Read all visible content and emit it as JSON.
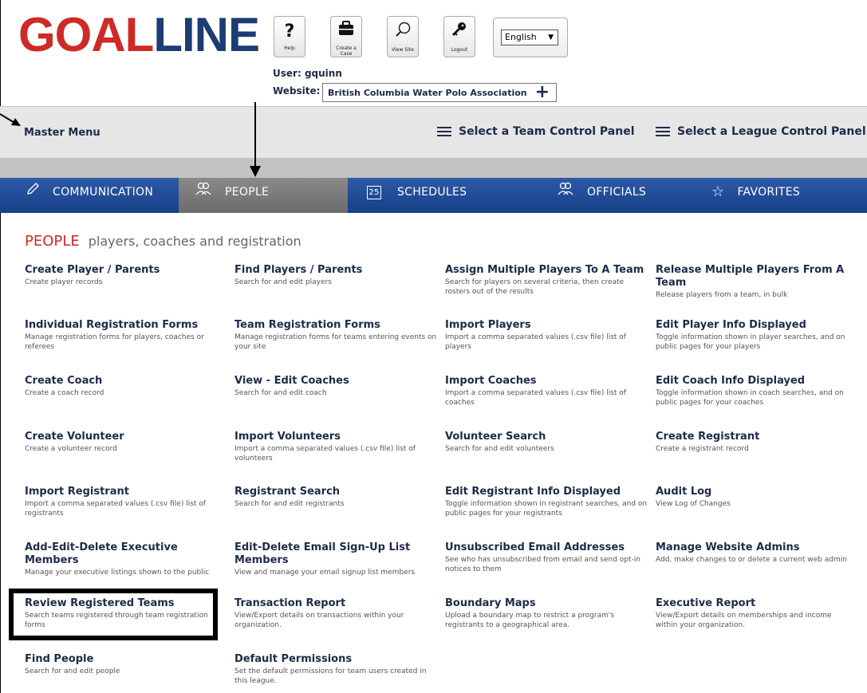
{
  "header": {
    "logo_goal": "GOAL",
    "logo_line": "LINE",
    "buttons": [
      {
        "icon": "help-icon",
        "glyph": "?",
        "label": "Help"
      },
      {
        "icon": "briefcase-icon",
        "glyph": "💼",
        "label": "Create a Case"
      },
      {
        "icon": "search-icon",
        "glyph": "⚲",
        "label": "View Site"
      },
      {
        "icon": "key-icon",
        "glyph": "⚷",
        "label": "Logout"
      }
    ],
    "language": "English",
    "user_label": "User:",
    "user_name": "gquinn",
    "website_label": "Website:",
    "website_value": "British Columbia Water Polo Association"
  },
  "menu_bar": {
    "master_menu": "Master Menu",
    "team_panel": "Select a Team Control Panel",
    "league_panel": "Select a League Control Panel"
  },
  "tabs": [
    {
      "label": "COMMUNICATION",
      "icon": "pencil-icon",
      "active": false
    },
    {
      "label": "PEOPLE",
      "icon": "people-icon",
      "active": true
    },
    {
      "label": "SCHEDULES",
      "icon": "calendar-icon",
      "calendar_day": "25",
      "active": false
    },
    {
      "label": "OFFICIALS",
      "icon": "officials-icon",
      "active": false
    },
    {
      "label": "FAVORITES",
      "icon": "star-icon",
      "active": false
    }
  ],
  "section": {
    "title": "PEOPLE",
    "subtitle": "players, coaches and registration"
  },
  "items": [
    {
      "title": "Create Player / Parents",
      "desc": "Create player records"
    },
    {
      "title": "Find Players / Parents",
      "desc": "Search for and edit players"
    },
    {
      "title": "Assign Multiple Players To A Team",
      "desc": "Search for players on several criteria, then create rosters out of the results"
    },
    {
      "title": "Release Multiple Players From A Team",
      "desc": "Release players from a team, in bulk"
    },
    {
      "title": "Individual Registration Forms",
      "desc": "Manage registration forms for players, coaches or referees"
    },
    {
      "title": "Team Registration Forms",
      "desc": "Manage registration forms for teams entering events on your site"
    },
    {
      "title": "Import Players",
      "desc": "Import a comma separated values (.csv file) list of players"
    },
    {
      "title": "Edit Player Info Displayed",
      "desc": "Toggle information shown in player searches, and on public pages for your players"
    },
    {
      "title": "Create Coach",
      "desc": "Create a coach record"
    },
    {
      "title": "View - Edit Coaches",
      "desc": "Search for and edit coach"
    },
    {
      "title": "Import Coaches",
      "desc": "Import a comma separated values (.csv file) list of coaches"
    },
    {
      "title": "Edit Coach Info Displayed",
      "desc": "Toggle information shown in coach searches, and on public pages for your coaches"
    },
    {
      "title": "Create Volunteer",
      "desc": "Create a volunteer record"
    },
    {
      "title": "Import Volunteers",
      "desc": "Import a comma separated values (.csv file) list of volunteers"
    },
    {
      "title": "Volunteer Search",
      "desc": "Search for and edit volunteers"
    },
    {
      "title": "Create Registrant",
      "desc": "Create a registrant record"
    },
    {
      "title": "Import Registrant",
      "desc": "Import a comma separated values (.csv file) list of registrants"
    },
    {
      "title": "Registrant Search",
      "desc": "Search for and edit registrants"
    },
    {
      "title": "Edit Registrant Info Displayed",
      "desc": "Toggle information shown in registrant searches, and on public pages for your registrants"
    },
    {
      "title": "Audit Log",
      "desc": "View Log of Changes"
    },
    {
      "title": "Add-Edit-Delete Executive Members",
      "desc": "Manage your executive listings shown to the public"
    },
    {
      "title": "Edit-Delete Email Sign-Up List Members",
      "desc": "View and manage your email signup list members"
    },
    {
      "title": "Unsubscribed Email Addresses",
      "desc": "See who has unsubscribed from email and send opt-in notices to them"
    },
    {
      "title": "Manage Website Admins",
      "desc": "Add, make changes to or delete a current web admin"
    },
    {
      "title": "Review Registered Teams",
      "desc": "Search teams registered through team registration forms"
    },
    {
      "title": "Transaction Report",
      "desc": "View/Export details on transactions within your organization."
    },
    {
      "title": "Boundary Maps",
      "desc": "Upload a boundary map to restrict a program's registrants to a geographical area."
    },
    {
      "title": "Executive Report",
      "desc": "View/Export details on memberships and income within your organization."
    },
    {
      "title": "Find People",
      "desc": "Search for and edit people"
    },
    {
      "title": "Default Permissions",
      "desc": "Set the default permissions for team users created in this league."
    }
  ]
}
